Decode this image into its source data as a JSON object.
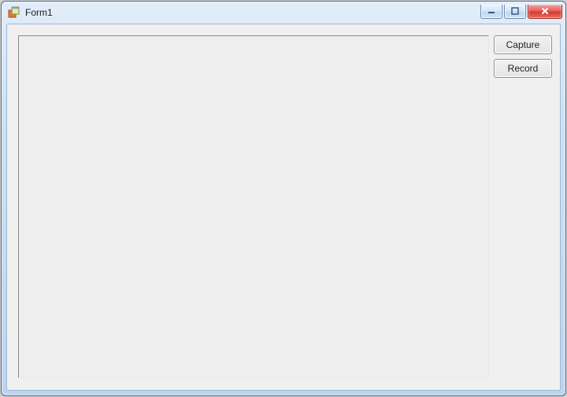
{
  "window": {
    "title": "Form1"
  },
  "buttons": {
    "capture": "Capture",
    "record": "Record"
  }
}
